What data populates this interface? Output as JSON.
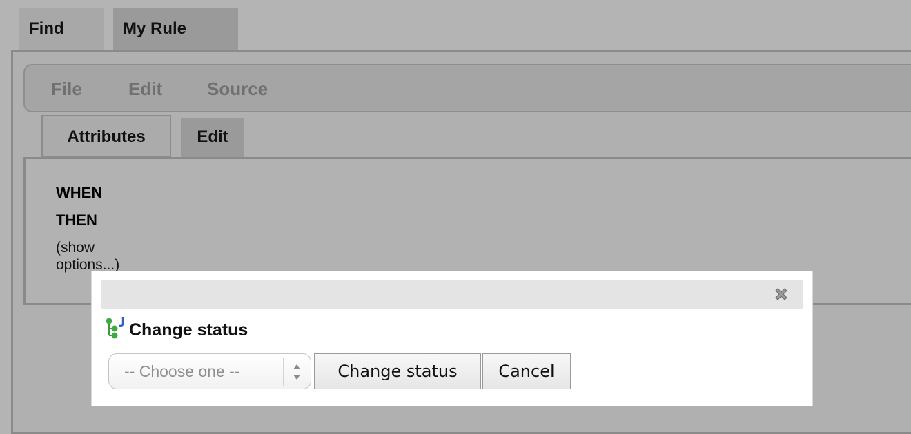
{
  "outer_tabs": [
    {
      "label": "Find"
    },
    {
      "label": "My Rule"
    }
  ],
  "menu": [
    {
      "label": "File"
    },
    {
      "label": "Edit"
    },
    {
      "label": "Source"
    }
  ],
  "inner_tabs": [
    {
      "label": "Attributes"
    },
    {
      "label": "Edit"
    }
  ],
  "rule": {
    "when_label": "WHEN",
    "then_label": "THEN",
    "options_link": "(show options...)"
  },
  "dialog": {
    "title": "Change status",
    "select": {
      "selected": "-- Choose one --"
    },
    "confirm_label": "Change status",
    "cancel_label": "Cancel",
    "icons": {
      "close": "close-icon",
      "title": "tree-rule-icon"
    }
  }
}
